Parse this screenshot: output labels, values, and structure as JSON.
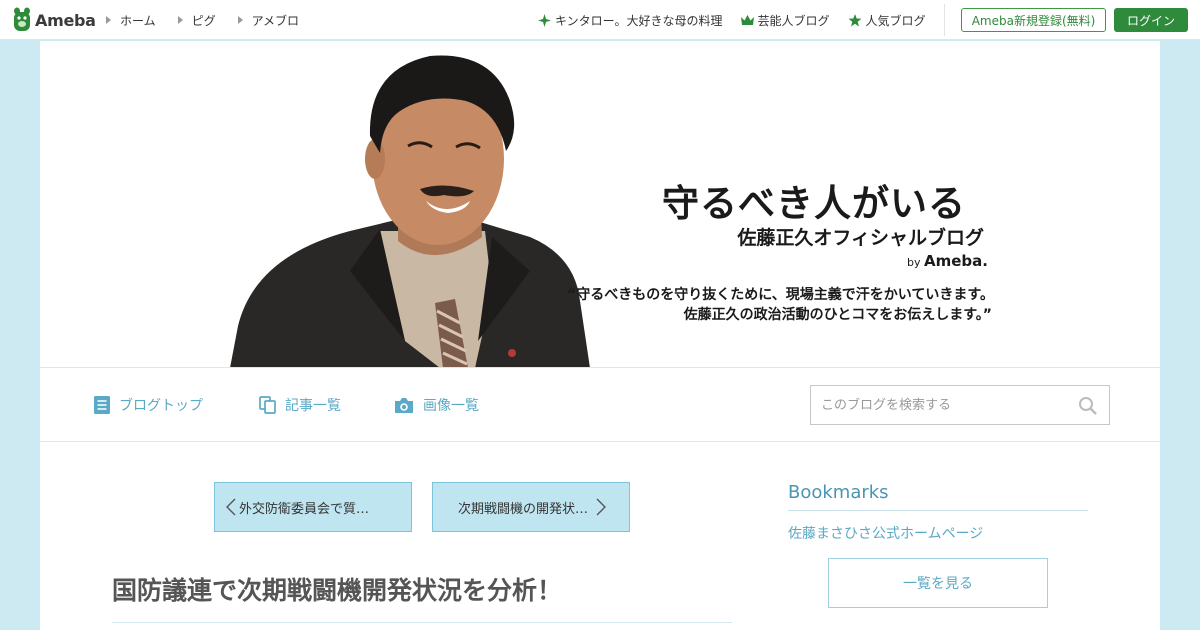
{
  "header": {
    "logo_text": "Ameba",
    "nav": [
      {
        "label": "ホーム"
      },
      {
        "label": "ピグ"
      },
      {
        "label": "アメブロ"
      }
    ],
    "links": [
      {
        "label": "キンタロー。大好きな母の料理",
        "icon": "sparkle-icon"
      },
      {
        "label": "芸能人ブログ",
        "icon": "crown-icon"
      },
      {
        "label": "人気ブログ",
        "icon": "star-icon"
      }
    ],
    "register_label": "Ameba新規登録(無料)",
    "login_label": "ログイン"
  },
  "hero": {
    "title": "守るべき人がいる",
    "subtitle": "佐藤正久オフィシャルブログ",
    "by_prefix": "by",
    "by_brand": "Ameba.",
    "quote_line1": "“守るべきものを守り抜くために、現場主義で汗をかいていきます。",
    "quote_line2": "佐藤正久の政治活動のひとコマをお伝えします。”"
  },
  "blog_nav": {
    "items": [
      {
        "label": "ブログトップ",
        "icon": "document-icon"
      },
      {
        "label": "記事一覧",
        "icon": "copy-icon"
      },
      {
        "label": "画像一覧",
        "icon": "camera-icon"
      }
    ],
    "search_placeholder": "このブログを検索する"
  },
  "article": {
    "prev_label": "外交防衛委員会で質…",
    "next_label": "次期戦闘機の開発状…",
    "title": "国防議連で次期戦闘機開発状況を分析！"
  },
  "sidebar": {
    "heading": "Bookmarks",
    "link": "佐藤まさひさ公式ホームページ",
    "button": "一覧を見る"
  },
  "colors": {
    "ameba_green": "#2e8b3b",
    "link_blue": "#5aa9c6",
    "background": "#cde9f1"
  }
}
